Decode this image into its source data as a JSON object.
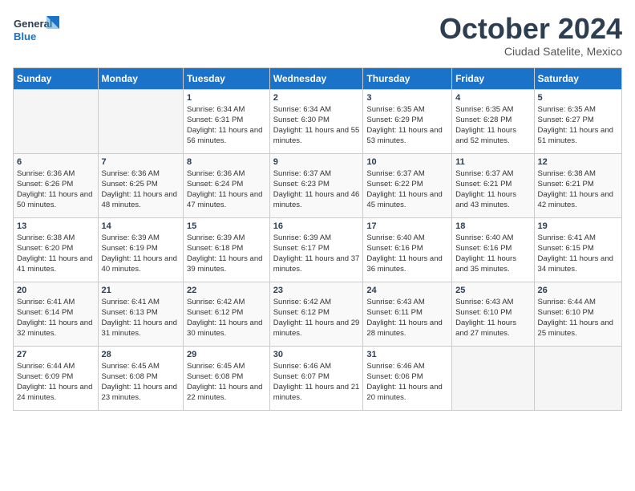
{
  "header": {
    "logo_line1": "General",
    "logo_line2": "Blue",
    "month": "October 2024",
    "location": "Ciudad Satelite, Mexico"
  },
  "weekdays": [
    "Sunday",
    "Monday",
    "Tuesday",
    "Wednesday",
    "Thursday",
    "Friday",
    "Saturday"
  ],
  "weeks": [
    [
      {
        "day": "",
        "info": ""
      },
      {
        "day": "",
        "info": ""
      },
      {
        "day": "1",
        "info": "Sunrise: 6:34 AM\nSunset: 6:31 PM\nDaylight: 11 hours and 56 minutes."
      },
      {
        "day": "2",
        "info": "Sunrise: 6:34 AM\nSunset: 6:30 PM\nDaylight: 11 hours and 55 minutes."
      },
      {
        "day": "3",
        "info": "Sunrise: 6:35 AM\nSunset: 6:29 PM\nDaylight: 11 hours and 53 minutes."
      },
      {
        "day": "4",
        "info": "Sunrise: 6:35 AM\nSunset: 6:28 PM\nDaylight: 11 hours and 52 minutes."
      },
      {
        "day": "5",
        "info": "Sunrise: 6:35 AM\nSunset: 6:27 PM\nDaylight: 11 hours and 51 minutes."
      }
    ],
    [
      {
        "day": "6",
        "info": "Sunrise: 6:36 AM\nSunset: 6:26 PM\nDaylight: 11 hours and 50 minutes."
      },
      {
        "day": "7",
        "info": "Sunrise: 6:36 AM\nSunset: 6:25 PM\nDaylight: 11 hours and 48 minutes."
      },
      {
        "day": "8",
        "info": "Sunrise: 6:36 AM\nSunset: 6:24 PM\nDaylight: 11 hours and 47 minutes."
      },
      {
        "day": "9",
        "info": "Sunrise: 6:37 AM\nSunset: 6:23 PM\nDaylight: 11 hours and 46 minutes."
      },
      {
        "day": "10",
        "info": "Sunrise: 6:37 AM\nSunset: 6:22 PM\nDaylight: 11 hours and 45 minutes."
      },
      {
        "day": "11",
        "info": "Sunrise: 6:37 AM\nSunset: 6:21 PM\nDaylight: 11 hours and 43 minutes."
      },
      {
        "day": "12",
        "info": "Sunrise: 6:38 AM\nSunset: 6:21 PM\nDaylight: 11 hours and 42 minutes."
      }
    ],
    [
      {
        "day": "13",
        "info": "Sunrise: 6:38 AM\nSunset: 6:20 PM\nDaylight: 11 hours and 41 minutes."
      },
      {
        "day": "14",
        "info": "Sunrise: 6:39 AM\nSunset: 6:19 PM\nDaylight: 11 hours and 40 minutes."
      },
      {
        "day": "15",
        "info": "Sunrise: 6:39 AM\nSunset: 6:18 PM\nDaylight: 11 hours and 39 minutes."
      },
      {
        "day": "16",
        "info": "Sunrise: 6:39 AM\nSunset: 6:17 PM\nDaylight: 11 hours and 37 minutes."
      },
      {
        "day": "17",
        "info": "Sunrise: 6:40 AM\nSunset: 6:16 PM\nDaylight: 11 hours and 36 minutes."
      },
      {
        "day": "18",
        "info": "Sunrise: 6:40 AM\nSunset: 6:16 PM\nDaylight: 11 hours and 35 minutes."
      },
      {
        "day": "19",
        "info": "Sunrise: 6:41 AM\nSunset: 6:15 PM\nDaylight: 11 hours and 34 minutes."
      }
    ],
    [
      {
        "day": "20",
        "info": "Sunrise: 6:41 AM\nSunset: 6:14 PM\nDaylight: 11 hours and 32 minutes."
      },
      {
        "day": "21",
        "info": "Sunrise: 6:41 AM\nSunset: 6:13 PM\nDaylight: 11 hours and 31 minutes."
      },
      {
        "day": "22",
        "info": "Sunrise: 6:42 AM\nSunset: 6:12 PM\nDaylight: 11 hours and 30 minutes."
      },
      {
        "day": "23",
        "info": "Sunrise: 6:42 AM\nSunset: 6:12 PM\nDaylight: 11 hours and 29 minutes."
      },
      {
        "day": "24",
        "info": "Sunrise: 6:43 AM\nSunset: 6:11 PM\nDaylight: 11 hours and 28 minutes."
      },
      {
        "day": "25",
        "info": "Sunrise: 6:43 AM\nSunset: 6:10 PM\nDaylight: 11 hours and 27 minutes."
      },
      {
        "day": "26",
        "info": "Sunrise: 6:44 AM\nSunset: 6:10 PM\nDaylight: 11 hours and 25 minutes."
      }
    ],
    [
      {
        "day": "27",
        "info": "Sunrise: 6:44 AM\nSunset: 6:09 PM\nDaylight: 11 hours and 24 minutes."
      },
      {
        "day": "28",
        "info": "Sunrise: 6:45 AM\nSunset: 6:08 PM\nDaylight: 11 hours and 23 minutes."
      },
      {
        "day": "29",
        "info": "Sunrise: 6:45 AM\nSunset: 6:08 PM\nDaylight: 11 hours and 22 minutes."
      },
      {
        "day": "30",
        "info": "Sunrise: 6:46 AM\nSunset: 6:07 PM\nDaylight: 11 hours and 21 minutes."
      },
      {
        "day": "31",
        "info": "Sunrise: 6:46 AM\nSunset: 6:06 PM\nDaylight: 11 hours and 20 minutes."
      },
      {
        "day": "",
        "info": ""
      },
      {
        "day": "",
        "info": ""
      }
    ]
  ]
}
